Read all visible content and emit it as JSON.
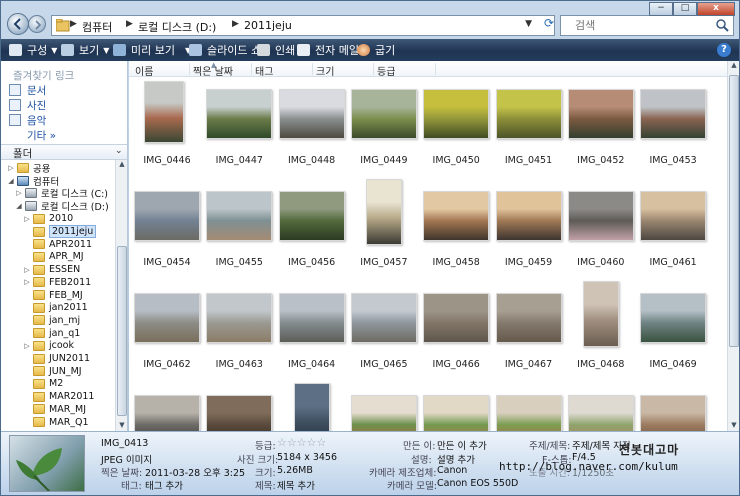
{
  "address": {
    "crumbs": [
      "컴퓨터",
      "로컬 디스크 (D:)",
      "2011jeju"
    ],
    "search_placeholder": "검색"
  },
  "caption": {
    "minimize": "−",
    "maximize": "□",
    "close": "x"
  },
  "toolbar": {
    "organize": "구성",
    "views": "보기",
    "preview": "미리 보기",
    "slideshow": "슬라이드 쇼",
    "print": "인쇄",
    "email": "전자 메일",
    "burn": "굽기",
    "help": "?"
  },
  "nav": {
    "favorites_title": "즐겨찾기 링크",
    "favorites": [
      "문서",
      "사진",
      "음악"
    ],
    "more": "기타 »",
    "folders_title": "폴더",
    "tree": [
      {
        "label": "공용",
        "icon": "folder",
        "indent": 1,
        "expander": "▷"
      },
      {
        "label": "컴퓨터",
        "icon": "pc",
        "indent": 1,
        "expander": "◢"
      },
      {
        "label": "로컬 디스크 (C:)",
        "icon": "drive",
        "indent": 2,
        "expander": "▷"
      },
      {
        "label": "로컬 디스크 (D:)",
        "icon": "drive",
        "indent": 2,
        "expander": "◢"
      },
      {
        "label": "2010",
        "icon": "folder",
        "indent": 3,
        "expander": "▷"
      },
      {
        "label": "2011jeju",
        "icon": "folder",
        "indent": 3,
        "expander": "",
        "selected": true
      },
      {
        "label": "APR2011",
        "icon": "folder",
        "indent": 3,
        "expander": ""
      },
      {
        "label": "APR_MJ",
        "icon": "folder",
        "indent": 3,
        "expander": ""
      },
      {
        "label": "ESSEN",
        "icon": "folder",
        "indent": 3,
        "expander": "▷"
      },
      {
        "label": "FEB2011",
        "icon": "folder",
        "indent": 3,
        "expander": "▷"
      },
      {
        "label": "FEB_MJ",
        "icon": "folder",
        "indent": 3,
        "expander": ""
      },
      {
        "label": "jan2011",
        "icon": "folder",
        "indent": 3,
        "expander": ""
      },
      {
        "label": "jan_mj",
        "icon": "folder",
        "indent": 3,
        "expander": ""
      },
      {
        "label": "jan_q1",
        "icon": "folder",
        "indent": 3,
        "expander": ""
      },
      {
        "label": "jcook",
        "icon": "folder",
        "indent": 3,
        "expander": "▷"
      },
      {
        "label": "JUN2011",
        "icon": "folder",
        "indent": 3,
        "expander": ""
      },
      {
        "label": "JUN_MJ",
        "icon": "folder",
        "indent": 3,
        "expander": ""
      },
      {
        "label": "M2",
        "icon": "folder",
        "indent": 3,
        "expander": ""
      },
      {
        "label": "MAR2011",
        "icon": "folder",
        "indent": 3,
        "expander": ""
      },
      {
        "label": "MAR_MJ",
        "icon": "folder",
        "indent": 3,
        "expander": ""
      },
      {
        "label": "MAR_Q1",
        "icon": "folder",
        "indent": 3,
        "expander": ""
      }
    ]
  },
  "columns": [
    "이름",
    "찍은 날짜",
    "태그",
    "크기",
    "등급"
  ],
  "files": [
    {
      "name": "IMG_0446",
      "colors": [
        "#c6c9c5",
        "#a96a4f",
        "#3a4733"
      ],
      "shape": "portrait"
    },
    {
      "name": "IMG_0447",
      "colors": [
        "#c7d0cf",
        "#6b7c4a",
        "#2f4a29"
      ],
      "shape": "land"
    },
    {
      "name": "IMG_0448",
      "colors": [
        "#d9dbe0",
        "#8a8f8f",
        "#4d4a3f"
      ],
      "shape": "land"
    },
    {
      "name": "IMG_0449",
      "colors": [
        "#a8b49a",
        "#7c8f4d",
        "#3c4a2a"
      ],
      "shape": "land"
    },
    {
      "name": "IMG_0450",
      "colors": [
        "#c5bf3d",
        "#93973a",
        "#3f4b22"
      ],
      "shape": "land"
    },
    {
      "name": "IMG_0451",
      "colors": [
        "#c3c34a",
        "#8d8f38",
        "#4c5329"
      ],
      "shape": "land"
    },
    {
      "name": "IMG_0452",
      "colors": [
        "#b78c77",
        "#7c5a41",
        "#33402f"
      ],
      "shape": "land"
    },
    {
      "name": "IMG_0453",
      "colors": [
        "#bfc3c7",
        "#8a6452",
        "#344233"
      ],
      "shape": "land"
    },
    {
      "name": "IMG_0454",
      "colors": [
        "#9ea7b0",
        "#728293",
        "#6c6b63"
      ],
      "shape": "land"
    },
    {
      "name": "IMG_0455",
      "colors": [
        "#bcc5ca",
        "#7e9093",
        "#a58b73"
      ],
      "shape": "land"
    },
    {
      "name": "IMG_0456",
      "colors": [
        "#8f9a7f",
        "#546a3d",
        "#2a3a22"
      ],
      "shape": "land"
    },
    {
      "name": "IMG_0457",
      "colors": [
        "#e9e3d1",
        "#b5a887",
        "#3c3a33"
      ],
      "shape": "tall"
    },
    {
      "name": "IMG_0458",
      "colors": [
        "#e3c9a3",
        "#a37752",
        "#3f352c"
      ],
      "shape": "land"
    },
    {
      "name": "IMG_0459",
      "colors": [
        "#e1c39a",
        "#a17955",
        "#3d3430"
      ],
      "shape": "land"
    },
    {
      "name": "IMG_0460",
      "colors": [
        "#8c8a86",
        "#5e5b57",
        "#c0a0a6"
      ],
      "shape": "land"
    },
    {
      "name": "IMG_0461",
      "colors": [
        "#d7c0a0",
        "#9a8670",
        "#4d4741"
      ],
      "shape": "land"
    },
    {
      "name": "IMG_0462",
      "colors": [
        "#b7bdc5",
        "#8c8d86",
        "#7a6e5b"
      ],
      "shape": "land"
    },
    {
      "name": "IMG_0463",
      "colors": [
        "#c2c7cc",
        "#9a9a92",
        "#8c7c67"
      ],
      "shape": "land"
    },
    {
      "name": "IMG_0464",
      "colors": [
        "#b9c0c7",
        "#848c8f",
        "#5c5d58"
      ],
      "shape": "land"
    },
    {
      "name": "IMG_0465",
      "colors": [
        "#c3c9cf",
        "#8e979d",
        "#6e6a62"
      ],
      "shape": "land"
    },
    {
      "name": "IMG_0466",
      "colors": [
        "#9d9488",
        "#827667",
        "#5e564c"
      ],
      "shape": "land"
    },
    {
      "name": "IMG_0467",
      "colors": [
        "#a89f93",
        "#847a6d",
        "#65594c"
      ],
      "shape": "land"
    },
    {
      "name": "IMG_0468",
      "colors": [
        "#cfc3b5",
        "#a08f80",
        "#6b5d50"
      ],
      "shape": "tall"
    },
    {
      "name": "IMG_0469",
      "colors": [
        "#b4c0c6",
        "#6f8384",
        "#3a5340"
      ],
      "shape": "land"
    },
    {
      "name": "",
      "colors": [
        "#b6b2aa",
        "#6d6b66",
        "#3b3836"
      ],
      "shape": "land"
    },
    {
      "name": "",
      "colors": [
        "#7f6c5a",
        "#5a4a3c",
        "#302820"
      ],
      "shape": "land"
    },
    {
      "name": "",
      "colors": [
        "#5c6f84",
        "#3f4f60",
        "#202a34"
      ],
      "shape": "tall"
    },
    {
      "name": "",
      "colors": [
        "#e5ddd0",
        "#6b8f4a",
        "#c86a3e"
      ],
      "shape": "land"
    },
    {
      "name": "",
      "colors": [
        "#e2d8c6",
        "#729a4f",
        "#c7713f"
      ],
      "shape": "land"
    },
    {
      "name": "",
      "colors": [
        "#d8cfbf",
        "#7b9d50",
        "#c0684a"
      ],
      "shape": "land"
    },
    {
      "name": "",
      "colors": [
        "#dedad2",
        "#8fa46d",
        "#b67a55"
      ],
      "shape": "land"
    },
    {
      "name": "",
      "colors": [
        "#c9b8a5",
        "#9c7c60",
        "#6a4d3a"
      ],
      "shape": "land"
    }
  ],
  "details": {
    "filename": "IMG_0413",
    "type": "JPEG 이미지",
    "date_label": "찍은 날짜:",
    "date_value": "2011-03-28 오후 3:25",
    "tags_label": "태그:",
    "tags_value": "태그 추가",
    "rating_label": "등급:",
    "rating_stars": "☆☆☆☆☆",
    "dimensions_label": "사진 크기:",
    "dimensions_value": "5184 x 3456",
    "size_label": "크기:",
    "size_value": "5.26MB",
    "title_label": "제목:",
    "title_value": "제목 추가",
    "author_label": "만든 이:",
    "author_value": "만든 이 추가",
    "comment_label": "설명:",
    "comment_value": "설명 추가",
    "maker_label": "카메라 제조업체:",
    "maker_value": "Canon",
    "model_label": "카메라 모델:",
    "model_value": "Canon EOS 550D",
    "subject_label": "주제/제목:",
    "subject_value": "주제/제목 지정",
    "fstop_label": "F-스톱:",
    "fstop_value": "F/4.5",
    "exposure_label": "노출 시간:",
    "exposure_value": "1/1250초",
    "watermark_name": "전봇대고마",
    "watermark_url": "http://blog.naver.com/kulum"
  }
}
